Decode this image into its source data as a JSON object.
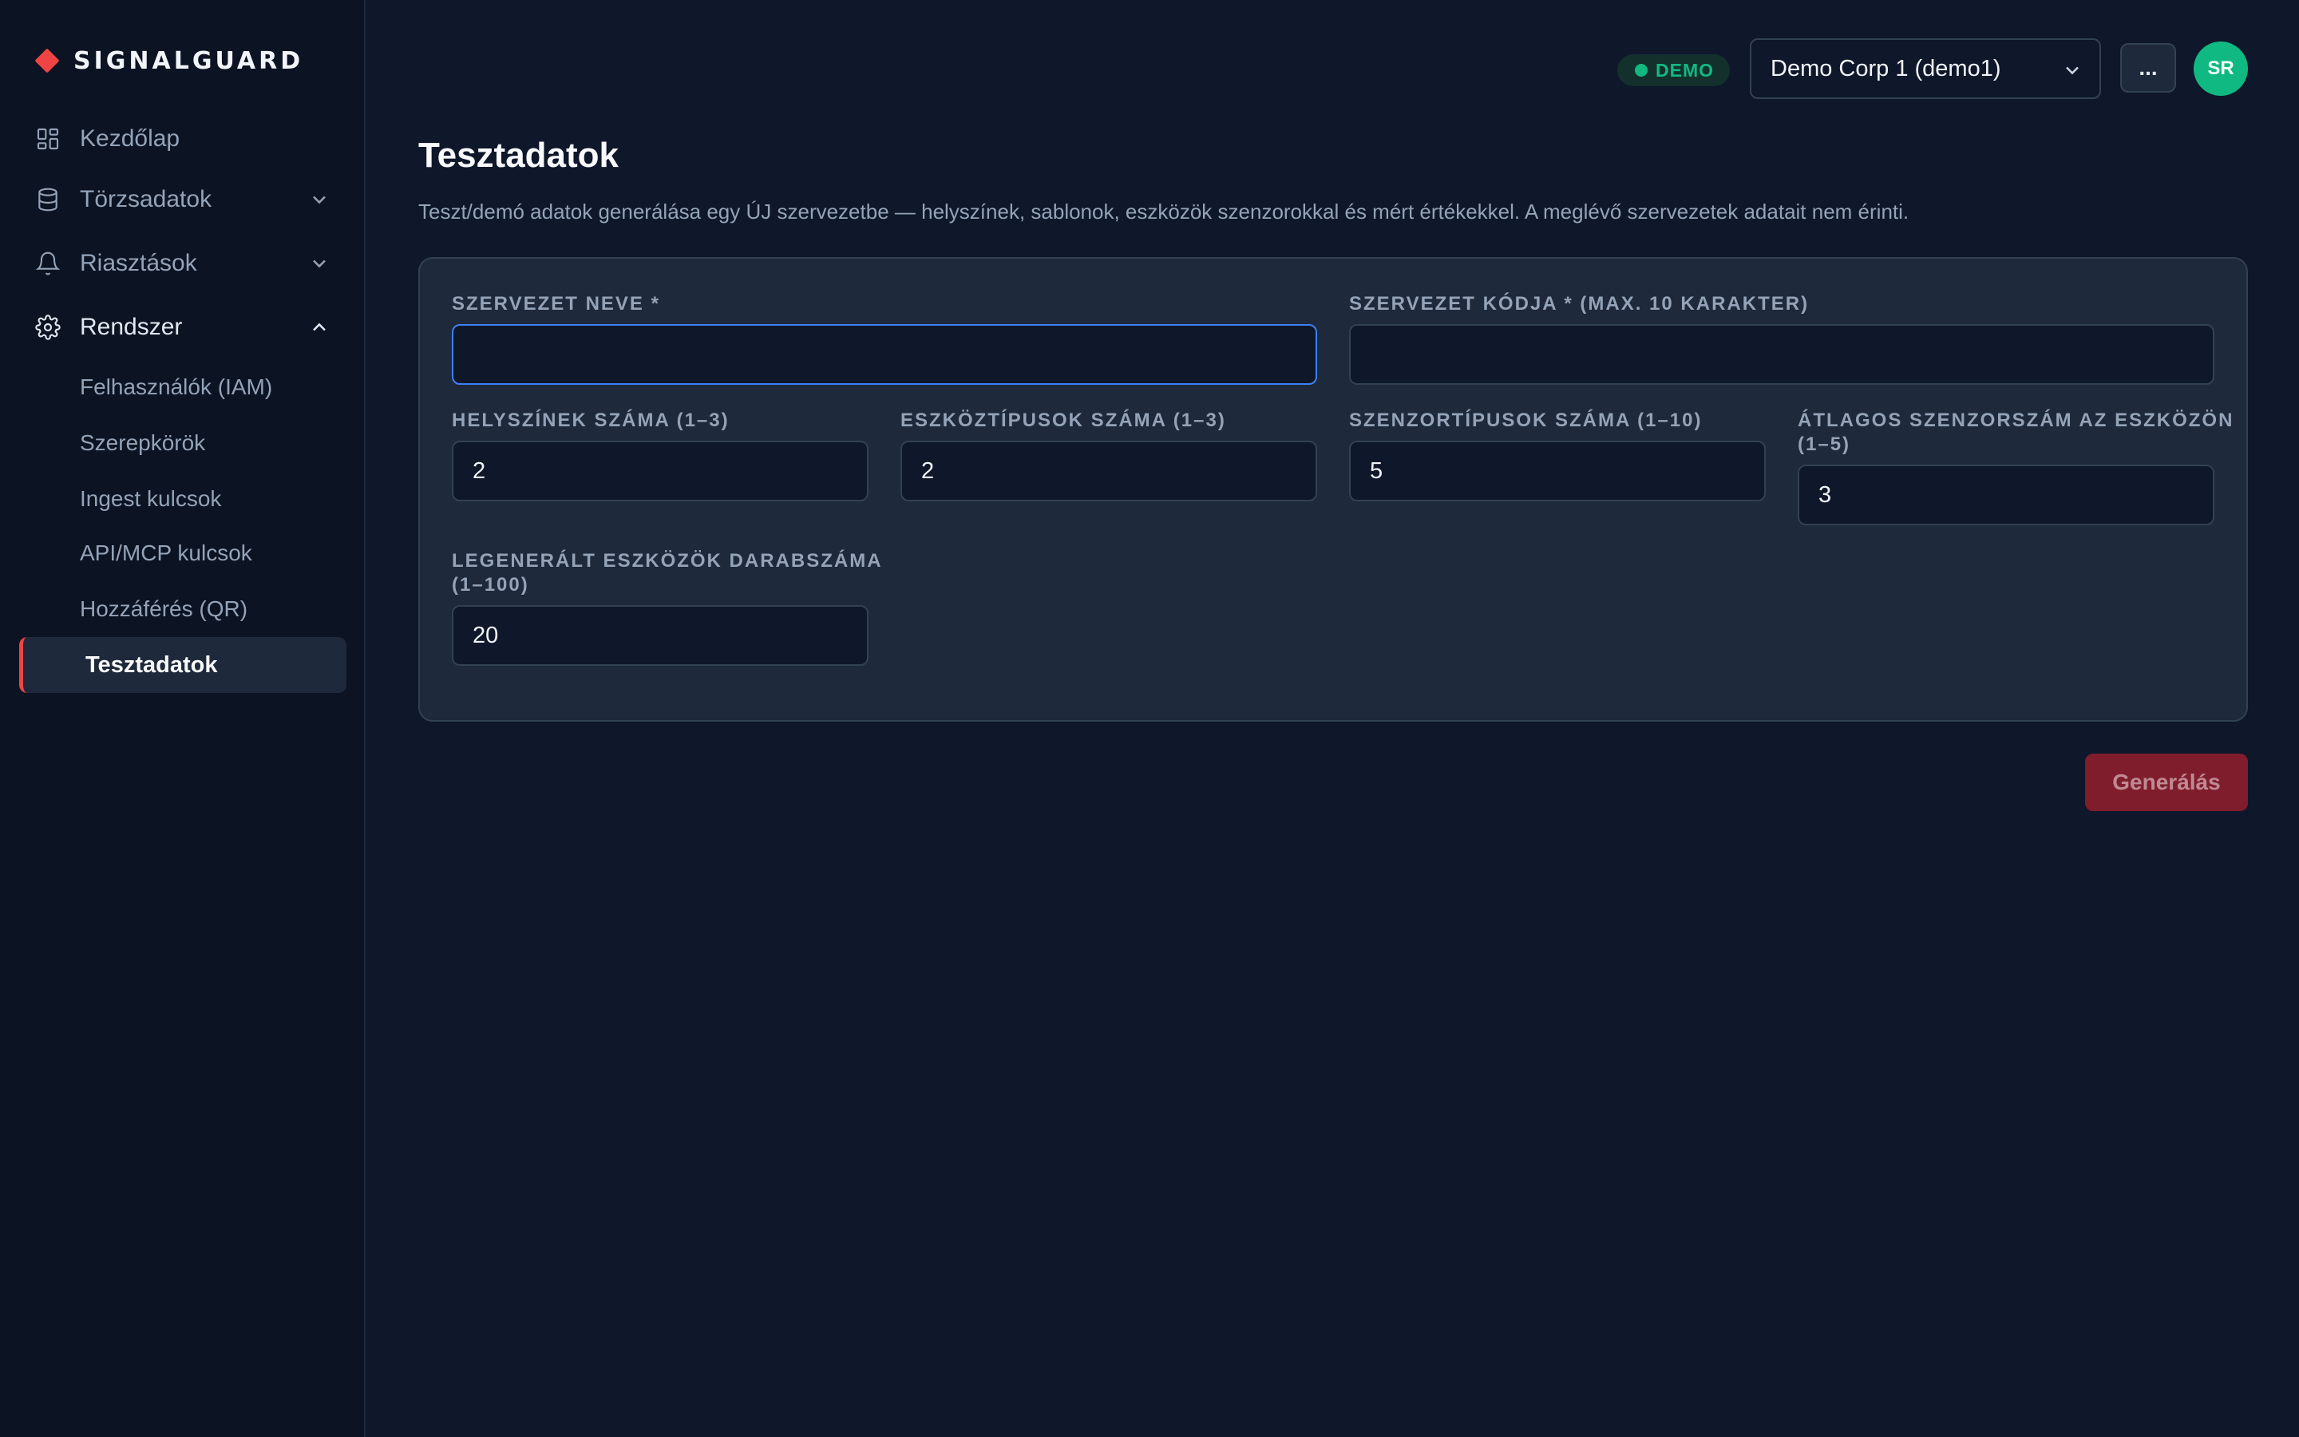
{
  "brand": {
    "name": "SIGNALGUARD",
    "accent": "#ef4444"
  },
  "sidebar": {
    "items": [
      {
        "label": "Kezdőlap",
        "icon": "dashboard-icon"
      },
      {
        "label": "Törzsadatok",
        "icon": "database-icon",
        "expanded": false
      },
      {
        "label": "Riasztások",
        "icon": "bell-icon",
        "expanded": false
      },
      {
        "label": "Rendszer",
        "icon": "gear-icon",
        "expanded": true
      }
    ],
    "subitems": [
      {
        "label": "Felhasználók (IAM)"
      },
      {
        "label": "Szerepkörök"
      },
      {
        "label": "Ingest kulcsok"
      },
      {
        "label": "API/MCP kulcsok"
      },
      {
        "label": "Hozzáférés (QR)"
      },
      {
        "label": "Tesztadatok",
        "active": true
      }
    ]
  },
  "header": {
    "badge": "DEMO",
    "badge_color": "#10b981",
    "org_select": "Demo Corp 1 (demo1)",
    "more_label": "...",
    "avatar_initials": "SR"
  },
  "main": {
    "title": "Tesztadatok",
    "description": "Teszt/demó adatok generálása egy ÚJ szervezetbe — helyszínek, sablonok, eszközök szenzorokkal és mért értékekkel. A meglévő szervezetek adatait nem érinti.",
    "fields": {
      "org_name": {
        "label": "SZERVEZET NEVE *",
        "value": ""
      },
      "org_code": {
        "label": "SZERVEZET KÓDJA * (MAX. 10 KARAKTER)",
        "value": ""
      },
      "sites": {
        "label": "HELYSZÍNEK SZÁMA (1–3)",
        "value": "2"
      },
      "device_types": {
        "label": "ESZKÖZTÍPUSOK SZÁMA (1–3)",
        "value": "2"
      },
      "sensor_types": {
        "label": "SZENZORTÍPUSOK SZÁMA (1–10)",
        "value": "5"
      },
      "avg_sensors_line1": "ÁTLAGOS SZENZORSZÁM AZ ESZKÖZÖN",
      "avg_sensors_line2": "(1–5)",
      "avg_sensors_value": "3",
      "devices_line1": "LEGENERÁLT ESZKÖZÖK DARABSZÁMA",
      "devices_line2": "(1–100)",
      "devices_value": "20"
    },
    "generate_label": "Generálás"
  }
}
